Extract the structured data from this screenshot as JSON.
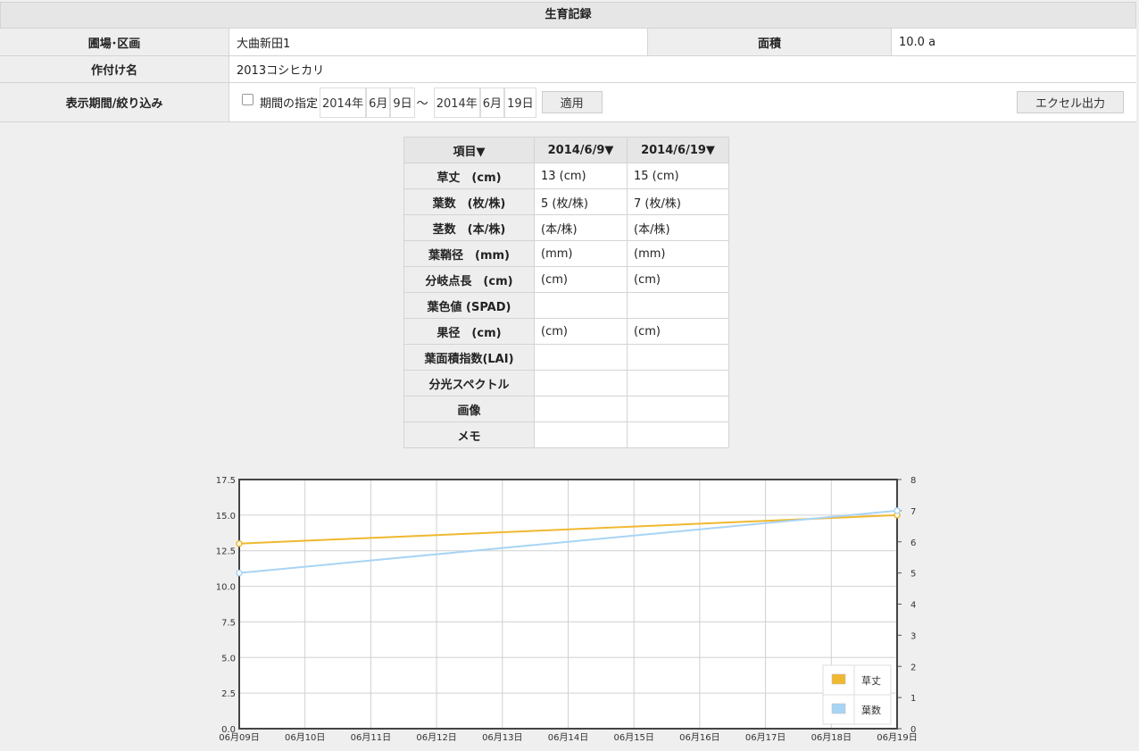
{
  "header": {
    "title": "生育記録"
  },
  "info": {
    "field_label": "圃場･区画",
    "field_value": "大曲新田1",
    "area_label": "面積",
    "area_value": "10.0 a",
    "crop_label": "作付け名",
    "crop_value": "2013コシヒカリ",
    "period_label": "表示期間/絞り込み",
    "period_checkbox_label": "期間の指定",
    "start": {
      "year": "2014年",
      "month": "6月",
      "day": "9日"
    },
    "tilde": "〜",
    "end": {
      "year": "2014年",
      "month": "6月",
      "day": "19日"
    },
    "apply_label": "適用",
    "excel_label": "エクセル出力"
  },
  "table": {
    "headers": [
      "項目▼",
      "2014/6/9▼",
      "2014/6/19▼"
    ],
    "rows": [
      {
        "label": "草丈　(cm)",
        "v1": "13 (cm)",
        "v2": "15 (cm)"
      },
      {
        "label": "葉数　(枚/株)",
        "v1": "5 (枚/株)",
        "v2": "7 (枚/株)"
      },
      {
        "label": "茎数　(本/株)",
        "v1": "(本/株)",
        "v2": "(本/株)"
      },
      {
        "label": "葉鞘径　(mm)",
        "v1": "(mm)",
        "v2": "(mm)"
      },
      {
        "label": "分岐点長　(cm)",
        "v1": "(cm)",
        "v2": "(cm)"
      },
      {
        "label": "葉色値 (SPAD)",
        "v1": "",
        "v2": ""
      },
      {
        "label": "果径　(cm)",
        "v1": "(cm)",
        "v2": "(cm)"
      },
      {
        "label": "葉面積指数(LAI)",
        "v1": "",
        "v2": ""
      },
      {
        "label": "分光スペクトル",
        "v1": "",
        "v2": ""
      },
      {
        "label": "画像",
        "v1": "",
        "v2": ""
      },
      {
        "label": "メモ",
        "v1": "",
        "v2": ""
      }
    ]
  },
  "chart_data": {
    "type": "line",
    "categories": [
      "06月09日",
      "06月10日",
      "06月11日",
      "06月12日",
      "06月13日",
      "06月14日",
      "06月15日",
      "06月16日",
      "06月17日",
      "06月18日",
      "06月19日"
    ],
    "y_left": {
      "min": 0,
      "max": 17.5,
      "ticks": [
        "0.0",
        "2.5",
        "5.0",
        "7.5",
        "10.0",
        "12.5",
        "15.0",
        "17.5"
      ]
    },
    "y_right": {
      "min": 0,
      "max": 8,
      "ticks": [
        "0",
        "1",
        "2",
        "3",
        "4",
        "5",
        "6",
        "7",
        "8"
      ]
    },
    "grid": true,
    "legend_position": "bottom-right",
    "series": [
      {
        "name": "草丈",
        "axis": "left",
        "color": "#f0b830",
        "points": [
          {
            "x": "06月09日",
            "y": 13
          },
          {
            "x": "06月19日",
            "y": 15
          }
        ]
      },
      {
        "name": "葉数",
        "axis": "right",
        "color": "#a8d4f4",
        "points": [
          {
            "x": "06月09日",
            "y": 5
          },
          {
            "x": "06月19日",
            "y": 7
          }
        ]
      }
    ]
  }
}
